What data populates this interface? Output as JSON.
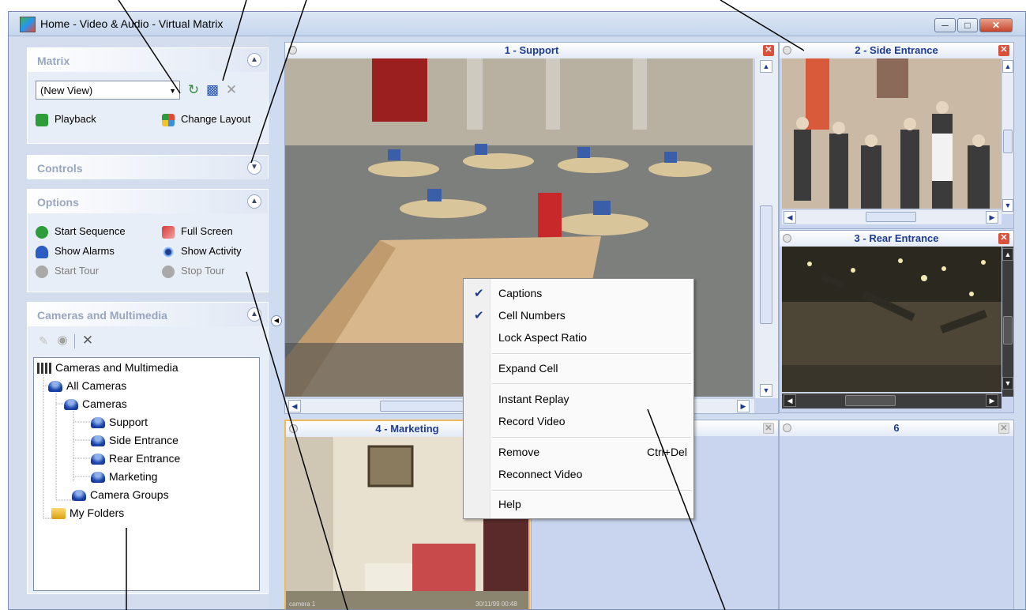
{
  "window": {
    "title": "Home - Video & Audio - Virtual Matrix"
  },
  "matrix": {
    "title": "Matrix",
    "view_select": "(New View)",
    "playback_label": "Playback",
    "change_layout_label": "Change Layout"
  },
  "controls": {
    "title": "Controls"
  },
  "options": {
    "title": "Options",
    "start_sequence": "Start Sequence",
    "full_screen": "Full Screen",
    "show_alarms": "Show Alarms",
    "show_activity": "Show Activity",
    "start_tour": "Start Tour",
    "stop_tour": "Stop Tour"
  },
  "cameras": {
    "title": "Cameras and Multimedia",
    "tree": {
      "root": "Cameras and Multimedia",
      "all_cameras": "All Cameras",
      "cameras_group": "Cameras",
      "cam_support": "Support",
      "cam_side": "Side Entrance",
      "cam_rear": "Rear Entrance",
      "cam_marketing": "Marketing",
      "camera_groups": "Camera Groups",
      "my_folders": "My Folders"
    }
  },
  "cells": {
    "c1": "1 - Support",
    "c2": "2 - Side Entrance",
    "c3": "3 - Rear Entrance",
    "c4": "4 - Marketing",
    "c5": "",
    "c6": "6",
    "c4_caption_left": "camera 1",
    "c4_caption_right": "30/11/99 00:48"
  },
  "context_menu": {
    "captions": "Captions",
    "cell_numbers": "Cell Numbers",
    "lock_aspect": "Lock Aspect Ratio",
    "expand_cell": "Expand Cell",
    "instant_replay": "Instant Replay",
    "record_video": "Record Video",
    "remove": "Remove",
    "remove_shortcut": "Ctrl+Del",
    "reconnect": "Reconnect Video",
    "help": "Help"
  }
}
